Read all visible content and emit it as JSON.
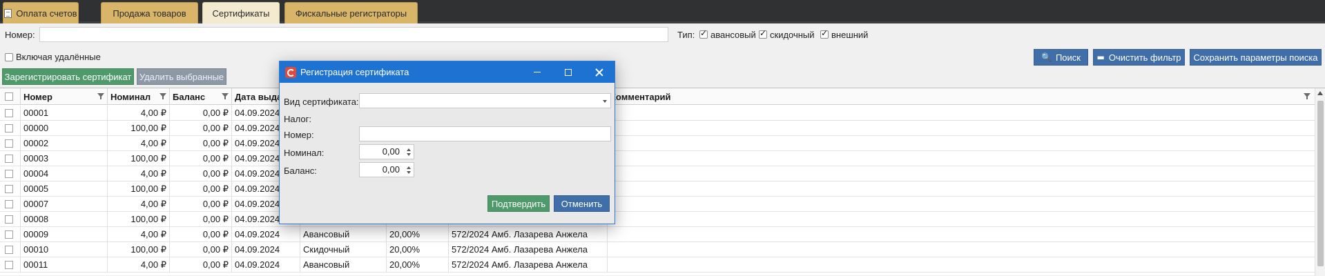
{
  "tabs": [
    {
      "label": "Оплата счетов",
      "active": false,
      "icon": "document-icon"
    },
    {
      "label": "Продажа товаров",
      "active": false
    },
    {
      "label": "Сертификаты",
      "active": true
    },
    {
      "label": "Фискальные регистраторы",
      "active": false
    }
  ],
  "filter": {
    "number_label": "Номер:",
    "number_value": "",
    "type_label": "Тип:",
    "types": [
      {
        "label": "авансовый",
        "checked": true
      },
      {
        "label": "скидочный",
        "checked": true
      },
      {
        "label": "внешний",
        "checked": true
      }
    ],
    "include_deleted_label": "Включая удалённые",
    "include_deleted_checked": false
  },
  "actions": {
    "search": "Поиск",
    "clear_filter": "Очистить фильтр",
    "save_search": "Сохранить параметры поиска",
    "register": "Зарегистрировать сертификат",
    "delete_selected": "Удалить выбранные"
  },
  "grid": {
    "columns": [
      "Номер",
      "Номинал",
      "Баланс",
      "Дата выда",
      "Комментарий"
    ],
    "rows": [
      {
        "number": "00001",
        "nominal": "4,00 ₽",
        "balance": "0,00 ₽",
        "date": "04.09.2024",
        "type": "",
        "tax": "",
        "comment": ""
      },
      {
        "number": "00000",
        "nominal": "100,00 ₽",
        "balance": "0,00 ₽",
        "date": "04.09.2024",
        "type": "",
        "tax": "",
        "comment": ""
      },
      {
        "number": "00002",
        "nominal": "4,00 ₽",
        "balance": "0,00 ₽",
        "date": "04.09.2024",
        "type": "",
        "tax": "",
        "comment": ""
      },
      {
        "number": "00003",
        "nominal": "100,00 ₽",
        "balance": "0,00 ₽",
        "date": "04.09.2024",
        "type": "",
        "tax": "",
        "comment": ""
      },
      {
        "number": "00004",
        "nominal": "4,00 ₽",
        "balance": "0,00 ₽",
        "date": "04.09.2024",
        "type": "",
        "tax": "",
        "comment": ""
      },
      {
        "number": "00005",
        "nominal": "100,00 ₽",
        "balance": "0,00 ₽",
        "date": "04.09.2024",
        "type": "",
        "tax": "",
        "comment": ""
      },
      {
        "number": "00007",
        "nominal": "4,00 ₽",
        "balance": "0,00 ₽",
        "date": "04.09.2024",
        "type": "",
        "tax": "",
        "comment": ""
      },
      {
        "number": "00008",
        "nominal": "100,00 ₽",
        "balance": "0,00 ₽",
        "date": "04.09.2024",
        "type": "",
        "tax": "",
        "comment": ""
      },
      {
        "number": "00009",
        "nominal": "4,00 ₽",
        "balance": "0,00 ₽",
        "date": "04.09.2024",
        "type": "Авансовый",
        "tax": "20,00%",
        "comment": "572/2024 Амб. Лазарева Анжела"
      },
      {
        "number": "00010",
        "nominal": "100,00 ₽",
        "balance": "0,00 ₽",
        "date": "04.09.2024",
        "type": "Скидочный",
        "tax": "20,00%",
        "comment": "572/2024 Амб. Лазарева Анжела"
      },
      {
        "number": "00011",
        "nominal": "4,00 ₽",
        "balance": "0,00 ₽",
        "date": "04.09.2024",
        "type": "Авансовый",
        "tax": "20,00%",
        "comment": "572/2024 Амб. Лазарева Анжела"
      }
    ]
  },
  "modal": {
    "title": "Регистрация сертификата",
    "cert_type_label": "Вид сертификата:",
    "cert_type_value": "",
    "tax_label": "Налог:",
    "number_label": "Номер:",
    "number_value": "",
    "nominal_label": "Номинал:",
    "nominal_value": "0,00",
    "balance_label": "Баланс:",
    "balance_value": "0,00",
    "confirm": "Подтвердить",
    "cancel": "Отменить"
  },
  "colors": {
    "tab_bg": "#d9b56a",
    "tab_active_bg": "#f3ead0",
    "button_blue": "#3f6ea8",
    "button_green": "#4e9a6a",
    "modal_title": "#1e73d2"
  }
}
